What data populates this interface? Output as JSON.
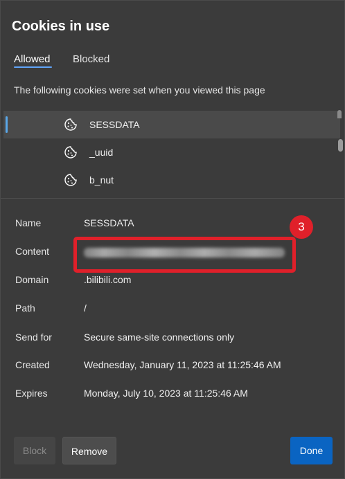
{
  "dialog": {
    "title": "Cookies in use",
    "tabs": [
      {
        "label": "Allowed",
        "active": true
      },
      {
        "label": "Blocked",
        "active": false
      }
    ],
    "subtitle": "The following cookies were set when you viewed this page"
  },
  "cookies": [
    {
      "name": "SESSDATA",
      "icon": "cookie-icon",
      "selected": true
    },
    {
      "name": "_uuid",
      "icon": "cookie-icon",
      "selected": false
    },
    {
      "name": "b_nut",
      "icon": "cookie-icon",
      "selected": false
    }
  ],
  "details": {
    "name_label": "Name",
    "name_value": "SESSDATA",
    "content_label": "Content",
    "content_value_redacted": true,
    "domain_label": "Domain",
    "domain_value": ".bilibili.com",
    "path_label": "Path",
    "path_value": "/",
    "send_for_label": "Send for",
    "send_for_value": "Secure same-site connections only",
    "created_label": "Created",
    "created_value": "Wednesday, January 11, 2023 at 11:25:46 AM",
    "expires_label": "Expires",
    "expires_value": "Monday, July 10, 2023 at 11:25:46 AM"
  },
  "annotation": {
    "step_number": "3",
    "color": "#e0202a"
  },
  "buttons": {
    "block_label": "Block",
    "remove_label": "Remove",
    "done_label": "Done"
  },
  "colors": {
    "accent": "#0a64c2",
    "tab_underline": "#60a5fa",
    "background": "#3b3b3b"
  }
}
